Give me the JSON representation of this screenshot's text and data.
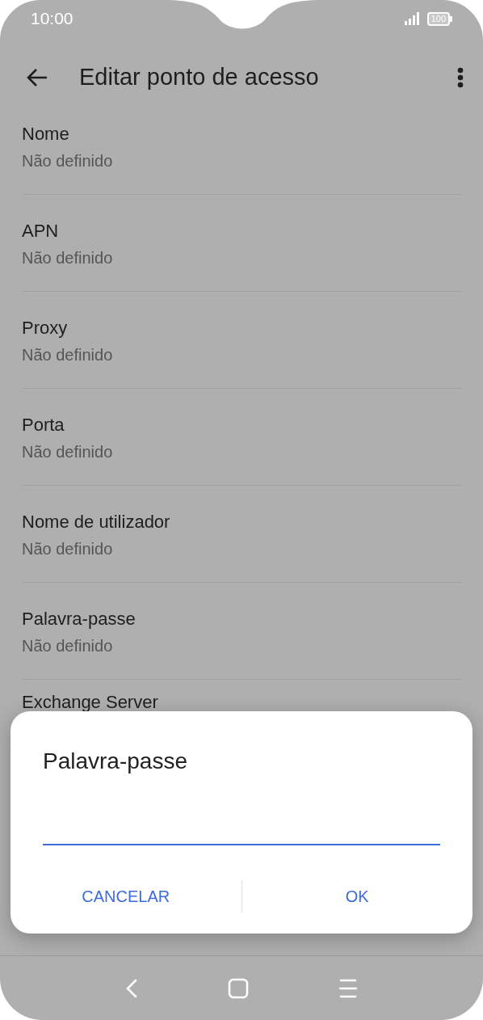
{
  "status_bar": {
    "time": "10:00",
    "battery": "100"
  },
  "app_bar": {
    "title": "Editar ponto de acesso"
  },
  "settings": [
    {
      "title": "Nome",
      "value": "Não definido"
    },
    {
      "title": "APN",
      "value": "Não definido"
    },
    {
      "title": "Proxy",
      "value": "Não definido"
    },
    {
      "title": "Porta",
      "value": "Não definido"
    },
    {
      "title": "Nome de utilizador",
      "value": "Não definido"
    },
    {
      "title": "Palavra-passe",
      "value": "Não definido"
    },
    {
      "title": "Exchange Server"
    }
  ],
  "dialog": {
    "title": "Palavra-passe",
    "buttons": [
      "CANCELAR",
      "OK"
    ]
  }
}
